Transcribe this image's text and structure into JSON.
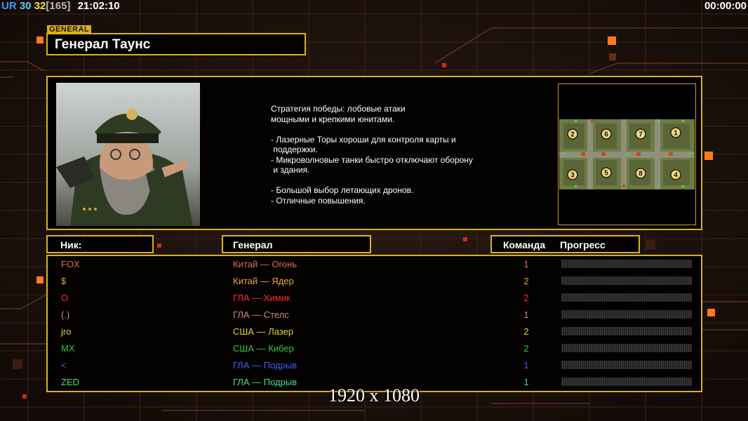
{
  "hud": {
    "ur": "UR",
    "fps": "30",
    "logic": "32",
    "ticks": "[165]",
    "clock": "21:02:10",
    "timer": "00:00:00"
  },
  "general": {
    "tag": "GENERAL",
    "name": "Генерал Таунс",
    "description": "Стратегия победы: лобовые атаки\nмощными и крепкими юнитами.\n\n- Лазерные Торы хороши для контроля карты и\n поддержки.\n- Микроволновые танки быстро отключают оборону\n и здания.\n\n- Большой выбор летающих дронов.\n- Отличные повышения."
  },
  "map": {
    "slots": [
      "2",
      "6",
      "7",
      "1",
      "3",
      "5",
      "8",
      "4"
    ]
  },
  "table": {
    "headers": {
      "nick": "Ник:",
      "general": "Генерал",
      "team": "Команда",
      "progress": "Прогресс"
    },
    "rows": [
      {
        "nick": "FOX",
        "general": "Китай — Огонь",
        "team": "1",
        "color": "#e06a5c"
      },
      {
        "nick": "$",
        "general": "Китай — Ядер",
        "team": "2",
        "color": "#f2a53a"
      },
      {
        "nick": "O",
        "general": "ГЛА — Химик",
        "team": "2",
        "color": "#ff2a2a"
      },
      {
        "nick": "(.)",
        "general": "ГЛА — Стелс",
        "team": "1",
        "color": "#d48b78"
      },
      {
        "nick": "jro",
        "general": "США — Лазер",
        "team": "2",
        "color": "#e6d23a"
      },
      {
        "nick": "MX",
        "general": "США — Кибер",
        "team": "2",
        "color": "#3ec23e"
      },
      {
        "nick": "<",
        "general": "ГЛА — Подрыв",
        "team": "1",
        "color": "#3f5cff"
      },
      {
        "nick": "ZED",
        "general": "ГЛА — Подрыв",
        "team": "1",
        "color": "#3fe08a"
      }
    ]
  },
  "overlay": {
    "resolution": "1920 x 1080"
  },
  "colors": {
    "accent": "#d9b21f",
    "background": "#1a0f0b",
    "orange_marker": "#ff7a1a"
  }
}
